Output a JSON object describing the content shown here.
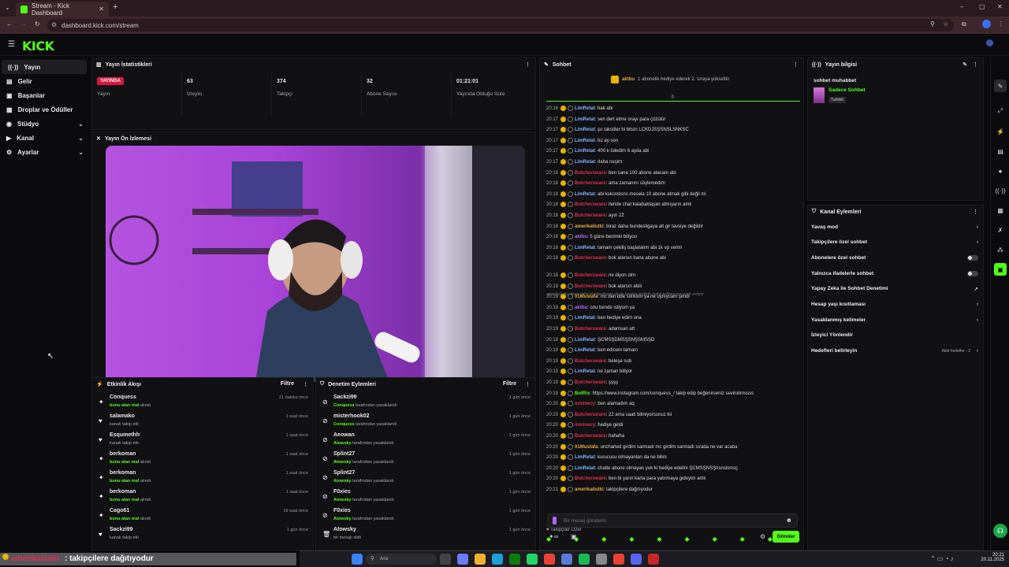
{
  "browser": {
    "tab_title": "Stream - Kick Dashboard",
    "url": "dashboard.kick.com/stream"
  },
  "app": {
    "logo": "KICK"
  },
  "sidebar": {
    "items": [
      {
        "label": "Yayın",
        "icon": "broadcast-icon"
      },
      {
        "label": "Gelir",
        "icon": "revenue-icon"
      },
      {
        "label": "Başarılar",
        "icon": "achievements-icon"
      },
      {
        "label": "Droplar ve Ödüller",
        "icon": "drops-icon"
      },
      {
        "label": "Stüdyo",
        "icon": "studio-icon"
      },
      {
        "label": "Kanal",
        "icon": "channel-icon"
      },
      {
        "label": "Ayarlar",
        "icon": "settings-icon"
      }
    ]
  },
  "stats": {
    "title": "Yayın İstatistikleri",
    "live_badge": "YAYINDA",
    "live_label": "Yayın",
    "viewers": "63",
    "viewers_label": "İzleyici",
    "followers": "374",
    "followers_label": "Takipçi",
    "subs": "32",
    "subs_label": "Abone Sayısı",
    "duration": "01:21:01",
    "duration_label": "Yayında Olduğu Süre"
  },
  "preview": {
    "title": "Yayın Ön İzlemesi"
  },
  "activity": {
    "title": "Etkinlik Akışı",
    "filter": "Filtre",
    "items": [
      {
        "name": "Conquess",
        "sub_hl": "bunu atan mal",
        "sub": "alındı",
        "time": "21 dakika önce"
      },
      {
        "name": "salamako",
        "sub_hl": "",
        "sub": "kanalı takip etti",
        "time": "1 saat önce"
      },
      {
        "name": "Esqumethh",
        "sub_hl": "",
        "sub": "kanalı takip etti",
        "time": "1 saat önce"
      },
      {
        "name": "berkoman",
        "sub_hl": "bunu atan mal",
        "sub": "alındı",
        "time": "1 saat önce"
      },
      {
        "name": "berkoman",
        "sub_hl": "bunu atan mal",
        "sub": "alındı",
        "time": "1 saat önce"
      },
      {
        "name": "berkoman",
        "sub_hl": "bunu atan mal",
        "sub": "alındı",
        "time": "1 saat önce"
      },
      {
        "name": "Cago61",
        "sub_hl": "bunu atan mal",
        "sub": "alındı",
        "time": "19 saat önce"
      },
      {
        "name": "Sackzi99",
        "sub_hl": "",
        "sub": "kanalı takip etti",
        "time": "1 gün önce"
      }
    ]
  },
  "moderation": {
    "title": "Denetim Eylemleri",
    "filter": "Filtre",
    "items": [
      {
        "name": "Sackzi99",
        "by": "Conquess",
        "sub": "tarafından yasaklandı",
        "time": "1 gün önce"
      },
      {
        "name": "misterhook02",
        "by": "Conquess",
        "sub": "tarafından yasaklandı",
        "time": "1 gün önce"
      },
      {
        "name": "Aeowan",
        "by": "Atowsky",
        "sub": "tarafından yasaklandı",
        "time": "1 gün önce"
      },
      {
        "name": "Splint27",
        "by": "Atowsky",
        "sub": "tarafından yasaklandı",
        "time": "1 gün önce"
      },
      {
        "name": "Splint27",
        "by": "Atowsky",
        "sub": "tarafından yasaklandı",
        "time": "1 gün önce"
      },
      {
        "name": "F0xies",
        "by": "Atowsky",
        "sub": "tarafından yasaklandı",
        "time": "1 gün önce"
      },
      {
        "name": "F0xies",
        "by": "Atowsky",
        "sub": "tarafından yasaklandı",
        "time": "1 gün önce"
      },
      {
        "name": "Atowsky",
        "by": "",
        "sub": "bir mesajı sildi",
        "time": "1 gün önce"
      }
    ]
  },
  "chat": {
    "title": "Sohbet",
    "pinned_user": "aktbu",
    "pinned_text": "1 abonelik hediye ederek 2. sıraya yükseltin",
    "followers_only": "Takipçiler Özel",
    "placeholder": "Bir mesaj gönderin",
    "send": "Gönder",
    "reply_hint": "amerikaliutki: biraz daha bundesligaya alt gir tavsiye değildir (aimli kullanıcıya yanıt veriyor",
    "messages": [
      {
        "t": "20:16",
        "u": "LimRetat",
        "c": "#7fb3ff",
        "m": "bak abi"
      },
      {
        "t": "20:17",
        "u": "LimRetat",
        "c": "#7fb3ff",
        "m": "sen dert etme orayı para çözülür"
      },
      {
        "t": "20:17",
        "u": "LimRetat",
        "c": "#7fb3ff",
        "m": "şu taksitler bi bitsin LCKDJSŞSNSLSNKSC"
      },
      {
        "t": "20:17",
        "u": "LimRetat",
        "c": "#7fb3ff",
        "m": "bu ay son"
      },
      {
        "t": "20:17",
        "u": "LimRetat",
        "c": "#7fb3ff",
        "m": "400 k ödedim 6 ayda abi"
      },
      {
        "t": "20:17",
        "u": "LimRetat",
        "c": "#7fb3ff",
        "m": "daha neşim"
      },
      {
        "t": "20:18",
        "u": "Butchersware",
        "c": "#e0304a",
        "m": "ben sana 100 abone atacam abi"
      },
      {
        "t": "20:18",
        "u": "Butchersware",
        "c": "#e0304a",
        "m": "ama zamanını söylemedim"
      },
      {
        "t": "20:18",
        "u": "LimRetat",
        "c": "#7fb3ff",
        "m": "abi ksksnslsns mesela 10 abone atmak gibi değil mi"
      },
      {
        "t": "20:18",
        "u": "Butchersware",
        "c": "#e0304a",
        "m": "ileride chat kalabaklaşan atmıyarın amk"
      },
      {
        "t": "20:18",
        "u": "Butchersware",
        "c": "#e0304a",
        "m": "ayın 22"
      },
      {
        "t": "20:18",
        "u": "amerikaliutki",
        "c": "#e8a93a",
        "m": "biraz daha bundesligaya alt gir tavsiye değildir"
      },
      {
        "t": "20:18",
        "u": "aktbu",
        "c": "#b066ff",
        "m": "5 güne benimki bitiyoo"
      },
      {
        "t": "20:18",
        "u": "LimRetat",
        "c": "#7fb3ff",
        "m": "tamam çekiliş başlatalım abi 1k vp verim"
      },
      {
        "t": "20:18",
        "u": "Butchersware",
        "c": "#e0304a",
        "m": "bok atarsın bana abone abi"
      },
      {
        "t": "20:18",
        "u": "Butchersware",
        "c": "#e0304a",
        "m": "ne diyon olm"
      },
      {
        "t": "20:19",
        "u": "Butchersware",
        "c": "#e0304a",
        "m": "bok atarsın abiii"
      },
      {
        "t": "20:19",
        "u": "01Mustafa",
        "c": "#e8a93a",
        "m": "mc den dde sıkıldım ya ne oynıycam şimdi"
      },
      {
        "t": "20:19",
        "u": "aktbu",
        "c": "#b066ff",
        "m": "onu bende istiyom ya"
      },
      {
        "t": "20:19",
        "u": "LimRetat",
        "c": "#7fb3ff",
        "m": "ben hediye edim ona"
      },
      {
        "t": "20:19",
        "u": "Butchersware",
        "c": "#e0304a",
        "m": "adamsan att"
      },
      {
        "t": "20:19",
        "u": "LimRetat",
        "c": "#7fb3ff",
        "m": "ŞCMSŞDMSŞSNŞSMSŞD"
      },
      {
        "t": "20:19",
        "u": "LimRetat",
        "c": "#7fb3ff",
        "m": "ben edicem tamam"
      },
      {
        "t": "20:19",
        "u": "Butchersware",
        "c": "#e0304a",
        "m": "beleşe sub"
      },
      {
        "t": "20:19",
        "u": "LimRetat",
        "c": "#7fb3ff",
        "m": "ne zaman bitiyor"
      },
      {
        "t": "20:19",
        "u": "Butchersware",
        "c": "#e0304a",
        "m": "şşşş"
      },
      {
        "t": "20:19",
        "u": "BotRix",
        "c": "#53fc18",
        "m": "https://www.instagram.com/conquess_/ takip edip beğenirseniz sevinirimssss"
      },
      {
        "t": "20:20",
        "u": "mminecy",
        "c": "#e0304a",
        "m": "ben alamadım aq"
      },
      {
        "t": "20:20",
        "u": "Butchersware",
        "c": "#e0304a",
        "m": "22 ama saati bilmiyorsunuz kii"
      },
      {
        "t": "20:20",
        "u": "mminecy",
        "c": "#e0304a",
        "m": "hediye geldi"
      },
      {
        "t": "20:20",
        "u": "Butchersware",
        "c": "#e0304a",
        "m": "hahaha"
      },
      {
        "t": "20:20",
        "u": "01Mustafa",
        "c": "#e8a93a",
        "m": "uncharted girdim sarmadı mc girdim sarmadı sırada ne var acaba"
      },
      {
        "t": "20:20",
        "u": "LimRetat",
        "c": "#7fb3ff",
        "m": "kurucusu olmayanları da ne bilim"
      },
      {
        "t": "20:20",
        "u": "LimRetat",
        "c": "#7fb3ff",
        "m": "chatte abone olmayan yok ki hediye edelim ŞCMSŞNSŞnsnslsmsç"
      },
      {
        "t": "20:20",
        "u": "Butchersware",
        "c": "#e0304a",
        "m": "ben bi yarın karta para yatırmaya gideyim amk"
      },
      {
        "t": "20:21",
        "u": "amerikaliutki",
        "c": "#e8a93a",
        "m": "takipçilere dağıtıyodur"
      }
    ]
  },
  "stream_info": {
    "title": "Yayın bilgisi",
    "stream_title": "sohbet muhabbet",
    "category": "Sadece Sohbet",
    "language": "Turkish"
  },
  "channel_actions": {
    "title": "Kanal Eylemleri",
    "rows": [
      {
        "label": "Yavaş mod",
        "ctrl": "›"
      },
      {
        "label": "Takipçilere özel sohbet",
        "ctrl": "›"
      },
      {
        "label": "Abonelere özel sohbet",
        "ctrl": "toggle"
      },
      {
        "label": "Yalnızca ifadelerle sohbet",
        "ctrl": "toggle"
      },
      {
        "label": "Yapay Zeka ile Sohbet Denetimi",
        "ctrl": "↗"
      },
      {
        "label": "Hesap yaşı kısıtlaması",
        "ctrl": "›"
      },
      {
        "label": "Yasaklanmış kelimeler",
        "ctrl": "›"
      },
      {
        "label": "İzleyici Yönlendir",
        "ctrl": ""
      },
      {
        "label": "Hedefleri belirleyin",
        "ctrl": "›"
      }
    ],
    "goals_status": "Aktif hedefler - 2"
  },
  "overlay": {
    "user": "amerikaliutki",
    "text": ": takipçilere dağıtıyodur"
  },
  "taskbar": {
    "search": "Ara",
    "time": "20:21",
    "date": "20.11.2025"
  },
  "colors": {
    "brand": "#53fc18",
    "live": "#d7193f"
  }
}
